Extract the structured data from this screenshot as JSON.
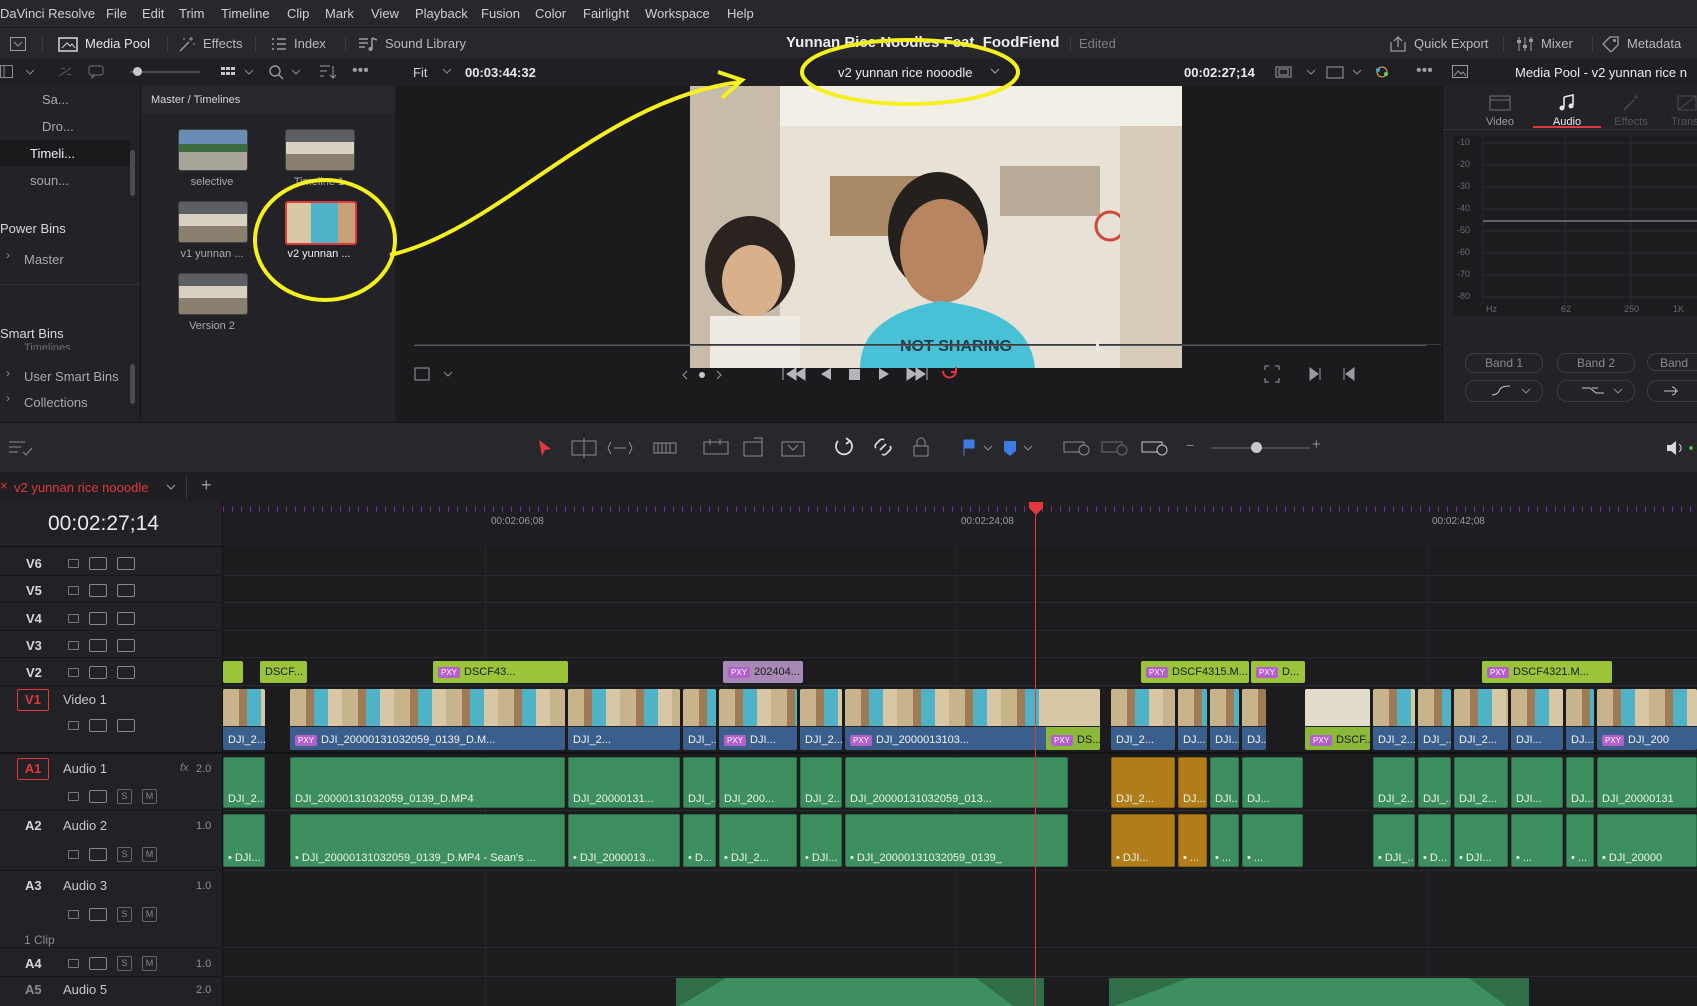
{
  "menu": {
    "app": "DaVinci Resolve",
    "items": [
      "File",
      "Edit",
      "Trim",
      "Timeline",
      "Clip",
      "Mark",
      "View",
      "Playback",
      "Fusion",
      "Color",
      "Fairlight",
      "Workspace",
      "Help"
    ]
  },
  "toolbar": {
    "media_pool": "Media Pool",
    "effects": "Effects",
    "index": "Index",
    "sound_library": "Sound Library",
    "project_title": "Yunnan Rice Noodles Feat. FoodFiend",
    "edited": "Edited",
    "quick_export": "Quick Export",
    "mixer": "Mixer",
    "metadata": "Metadata"
  },
  "viewer_bar": {
    "fit": "Fit",
    "source_timecode": "00:03:44:32",
    "timeline_select": "v2 yunnan rice nooodle",
    "timecode": "00:02:27;14",
    "inspector_title": "Media Pool - v2 yunnan rice n"
  },
  "bins": {
    "items": [
      "Sa...",
      "Dro...",
      "Timeli...",
      "soun..."
    ],
    "power_bins": "Power Bins",
    "power_master": "Master",
    "smart_bins": "Smart Bins",
    "smart_timelines": "Timelines",
    "user_smart_bins": "User Smart Bins",
    "collections": "Collections"
  },
  "media_pool": {
    "breadcrumb": "Master / Timelines",
    "clips": [
      "selective",
      "Timeline 1",
      "v1 yunnan ...",
      "v2 yunnan ...",
      "Version 2"
    ]
  },
  "inspector": {
    "tabs": [
      "Video",
      "Audio",
      "Effects",
      "Transiti"
    ],
    "db_labels": [
      "-10",
      "-20",
      "-30",
      "-40",
      "-50",
      "-60",
      "-70",
      "-80"
    ],
    "freq_labels": [
      "Hz",
      "62",
      "250",
      "1K"
    ],
    "bands": [
      "Band 1",
      "Band 2",
      "Band"
    ]
  },
  "timeline": {
    "tab_name": "v2 yunnan rice nooodle",
    "timecode": "00:02:27;14",
    "ruler": [
      "00:02:06;08",
      "00:02:24;08",
      "00:02:42;08"
    ],
    "footer_note": "1 Clip",
    "tracks": [
      {
        "id": "V6",
        "name": ""
      },
      {
        "id": "V5",
        "name": ""
      },
      {
        "id": "V4",
        "name": ""
      },
      {
        "id": "V3",
        "name": ""
      },
      {
        "id": "V2",
        "name": ""
      },
      {
        "id": "V1",
        "name": "Video 1"
      },
      {
        "id": "A1",
        "name": "Audio 1",
        "vol": "2.0",
        "fx": "fx"
      },
      {
        "id": "A2",
        "name": "Audio 2",
        "vol": "1.0"
      },
      {
        "id": "A3",
        "name": "Audio 3",
        "vol": "1.0"
      },
      {
        "id": "A4",
        "name": "",
        "vol": "1.0"
      },
      {
        "id": "A5",
        "name": "Audio 5",
        "vol": "2.0"
      }
    ],
    "v2_clips": [
      "DSCF...",
      "DSCF43...",
      "202404...",
      "DSCF4315.M...",
      "D...",
      "DSCF4321.M..."
    ],
    "v1_clips": [
      "DJI_2...",
      "DJI_20000131032059_0139_D.M...",
      "DJI_2...",
      "DJI_...",
      "DJI...",
      "DJI_2...",
      "DJI_2000013103...",
      "DS...",
      "DJI_2...",
      "DJ...",
      "DJI...",
      "DJ...",
      "DSCF...",
      "DJI_2...",
      "DJI_...",
      "DJI_2...",
      "DJI...",
      "DJ...",
      "DJI_200"
    ],
    "a1_clips": [
      "DJI_2...",
      "DJI_20000131032059_0139_D.MP4",
      "DJI_20000131...",
      "DJI_...",
      "DJI_200...",
      "DJI_2...",
      "DJI_20000131032059_013...",
      "DJI_2...",
      "DJ...",
      "DJI...",
      "DJ...",
      "DJI_2...",
      "DJI_...",
      "DJI_2...",
      "DJI...",
      "DJ...",
      "DJI_20000131"
    ],
    "a2_clips": [
      "• DJI...",
      "• DJI_20000131032059_0139_D.MP4 - Sean's ...",
      "• DJI_2000013...",
      "• D...",
      "• DJI_2...",
      "• DJI...",
      "• DJI_20000131032059_0139_",
      "• DJI...",
      "• ...",
      "• ...",
      "• ...",
      "• DJI_...",
      "• D...",
      "• DJI...",
      "• ...",
      "• ...",
      "• DJI_20000"
    ]
  },
  "colors": {
    "accent_red": "#e0383c",
    "audio_green": "#3e8f5f",
    "audio_orange": "#b07d1a",
    "v2_green": "#9bc43a",
    "v1_blue": "#3b5f8c",
    "annotation_yellow": "#f5f01e"
  }
}
